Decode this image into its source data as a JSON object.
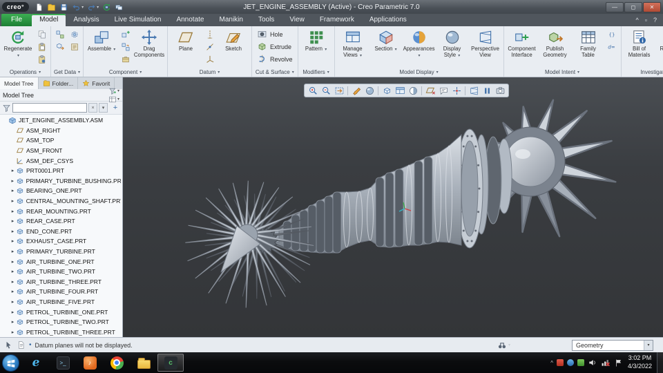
{
  "colors": {
    "file_tab_green": "#1f9138",
    "ribbon_background": "#e9edf2",
    "viewport_background": "#3a3d41",
    "taskbar_background": "#0d0e10",
    "selection_blue": "#3d6ea8"
  },
  "titlebar": {
    "logo_text": "creo°",
    "title": "JET_ENGINE_ASSEMBLY (Active) - Creo Parametric 7.0",
    "quick_access": [
      "new-file",
      "open-file",
      "save",
      "undo",
      "redo",
      "regenerate",
      "windows-mini"
    ],
    "window_buttons": [
      {
        "name": "minimize",
        "glyph": "—"
      },
      {
        "name": "maximize",
        "glyph": "◻"
      },
      {
        "name": "close",
        "glyph": "✕"
      }
    ]
  },
  "tab_row": {
    "tabs": [
      {
        "label": "File",
        "kind": "file"
      },
      {
        "label": "Model",
        "active": true
      },
      {
        "label": "Analysis"
      },
      {
        "label": "Live Simulation"
      },
      {
        "label": "Annotate"
      },
      {
        "label": "Manikin"
      },
      {
        "label": "Tools"
      },
      {
        "label": "View"
      },
      {
        "label": "Framework"
      },
      {
        "label": "Applications"
      }
    ],
    "right_icons": [
      {
        "name": "collapse-ribbon",
        "glyph": "^"
      },
      {
        "name": "switch-windows",
        "glyph": "▫"
      },
      {
        "name": "help",
        "glyph": "?"
      }
    ]
  },
  "ribbon": {
    "groups": [
      {
        "label": "Operations",
        "cells": [
          {
            "kind": "large",
            "label": "Regenerate",
            "icon": "regenerate",
            "caret": true
          },
          {
            "kind": "stack",
            "icons": [
              "copy",
              "paste",
              "paste-special"
            ]
          }
        ]
      },
      {
        "label": "Get Data",
        "cells": [
          {
            "kind": "stack",
            "icons": [
              "user-defined-feature",
              "copy-geometry"
            ]
          },
          {
            "kind": "stack",
            "icons": [
              "shrinkwrap",
              "legacy-data"
            ]
          }
        ]
      },
      {
        "label": "Component",
        "cells": [
          {
            "kind": "large",
            "label": "Assemble",
            "icon": "assemble",
            "caret": true
          },
          {
            "kind": "stack",
            "icons": [
              "create-component",
              "repeat",
              "package"
            ]
          },
          {
            "kind": "large",
            "label": "Drag Components",
            "icon": "drag-components"
          }
        ]
      },
      {
        "label": "Datum",
        "cells": [
          {
            "kind": "large",
            "label": "Plane",
            "icon": "datum-plane"
          },
          {
            "kind": "stack",
            "icons": [
              "datum-axis",
              "datum-point",
              "datum-csys"
            ]
          },
          {
            "kind": "large",
            "label": "Sketch",
            "icon": "sketch"
          }
        ]
      },
      {
        "label": "Cut & Surface",
        "cells": [
          {
            "kind": "rows",
            "rows": [
              {
                "label": "Hole",
                "icon": "hole"
              },
              {
                "label": "Extrude",
                "icon": "extrude"
              },
              {
                "label": "Revolve",
                "icon": "revolve"
              }
            ]
          }
        ]
      },
      {
        "label": "Modifiers",
        "cells": [
          {
            "kind": "large",
            "label": "Pattern",
            "icon": "pattern",
            "caret": true
          }
        ]
      },
      {
        "label": "Model Display",
        "cells": [
          {
            "kind": "large",
            "label": "Manage Views",
            "icon": "manage-views",
            "caret": true
          },
          {
            "kind": "large",
            "label": "Section",
            "icon": "section",
            "caret": true
          },
          {
            "kind": "large",
            "label": "Appearances",
            "icon": "appearances",
            "caret": true
          },
          {
            "kind": "large",
            "label": "Display Style",
            "icon": "display-style",
            "caret": true
          },
          {
            "kind": "large",
            "label": "Perspective View",
            "icon": "perspective-view"
          }
        ]
      },
      {
        "label": "Model Intent",
        "cells": [
          {
            "kind": "large",
            "label": "Component Interface",
            "icon": "component-interface"
          },
          {
            "kind": "large",
            "label": "Publish Geometry",
            "icon": "publish-geometry"
          },
          {
            "kind": "large",
            "label": "Family Table",
            "icon": "family-table"
          },
          {
            "kind": "stack",
            "icons": [
              "relations",
              "parameters"
            ]
          }
        ]
      },
      {
        "label": "Investigate",
        "cells": [
          {
            "kind": "large",
            "label": "Bill of Materials",
            "icon": "bill-of-materials"
          },
          {
            "kind": "large",
            "label": "Reference Viewer",
            "icon": "reference-viewer"
          }
        ]
      }
    ]
  },
  "graphics_toolbar": {
    "icons": [
      "zoom-in",
      "zoom-out",
      "refit",
      "sep",
      "repaint",
      "shaded-view",
      "sep",
      "saved-orientations",
      "view-manager",
      "display-style-toggle",
      "sep",
      "datum-display",
      "annotation-display",
      "spin-center",
      "sep",
      "perspective-toggle",
      "pause",
      "capture"
    ]
  },
  "model_tree_panel": {
    "tabs": [
      {
        "label": "Model Tree",
        "active": true
      },
      {
        "label": "Folder...",
        "icon": "folder"
      },
      {
        "label": "Favorit",
        "icon": "star"
      }
    ],
    "header_title": "Model Tree",
    "header_icons": [
      "tree-filters",
      "tree-columns"
    ],
    "search": {
      "value": ""
    },
    "items": [
      {
        "label": "JET_ENGINE_ASSEMBLY.ASM",
        "icon": "assembly",
        "indent": 0
      },
      {
        "label": "ASM_RIGHT",
        "icon": "datum-plane-item",
        "indent": 1
      },
      {
        "label": "ASM_TOP",
        "icon": "datum-plane-item",
        "indent": 1
      },
      {
        "label": "ASM_FRONT",
        "icon": "datum-plane-item",
        "indent": 1
      },
      {
        "label": "ASM_DEF_CSYS",
        "icon": "csys-item",
        "indent": 1
      },
      {
        "label": "PRT0001.PRT",
        "icon": "part",
        "indent": 1,
        "expandable": true
      },
      {
        "label": "PRIMARY_TURBINE_BUSHING.PRT",
        "icon": "part",
        "indent": 1,
        "expandable": true
      },
      {
        "label": "BEARING_ONE.PRT",
        "icon": "part",
        "indent": 1,
        "expandable": true
      },
      {
        "label": "CENTRAL_MOUNTING_SHAFT.PRT",
        "icon": "part",
        "indent": 1,
        "expandable": true
      },
      {
        "label": "REAR_MOUNTING.PRT",
        "icon": "part",
        "indent": 1,
        "expandable": true
      },
      {
        "label": "REAR_CASE.PRT",
        "icon": "part",
        "indent": 1,
        "expandable": true
      },
      {
        "label": "END_CONE.PRT",
        "icon": "part",
        "indent": 1,
        "expandable": true
      },
      {
        "label": "EXHAUST_CASE.PRT",
        "icon": "part",
        "indent": 1,
        "expandable": true
      },
      {
        "label": "PRIMARY_TURBINE.PRT",
        "icon": "part",
        "indent": 1,
        "expandable": true
      },
      {
        "label": "AIR_TURBINE_ONE.PRT",
        "icon": "part",
        "indent": 1,
        "expandable": true
      },
      {
        "label": "AIR_TURBINE_TWO.PRT",
        "icon": "part",
        "indent": 1,
        "expandable": true
      },
      {
        "label": "AIR_TURBINE_THREE.PRT",
        "icon": "part",
        "indent": 1,
        "expandable": true
      },
      {
        "label": "AIR_TURBINE_FOUR.PRT",
        "icon": "part",
        "indent": 1,
        "expandable": true
      },
      {
        "label": "AIR_TURBINE_FIVE.PRT",
        "icon": "part",
        "indent": 1,
        "expandable": true
      },
      {
        "label": "PETROL_TURBINE_ONE.PRT",
        "icon": "part",
        "indent": 1,
        "expandable": true
      },
      {
        "label": "PETROL_TURBINE_TWO.PRT",
        "icon": "part",
        "indent": 1,
        "expandable": true
      },
      {
        "label": "PETROL_TURBINE_THREE.PRT",
        "icon": "part",
        "indent": 1,
        "expandable": true
      }
    ]
  },
  "status_bar": {
    "message": "Datum planes will not be displayed.",
    "selection_filter": "Geometry"
  },
  "taskbar": {
    "items": [
      "internet-explorer",
      "app-dark",
      "app-orange",
      "chrome",
      "file-explorer",
      "creo-active"
    ],
    "tray": [
      "tray-chevron",
      "tray-red",
      "tray-blue",
      "tray-green",
      "tray-volume",
      "tray-network",
      "tray-flag"
    ],
    "clock": {
      "time": "3:02 PM",
      "date": "4/3/2022"
    }
  }
}
